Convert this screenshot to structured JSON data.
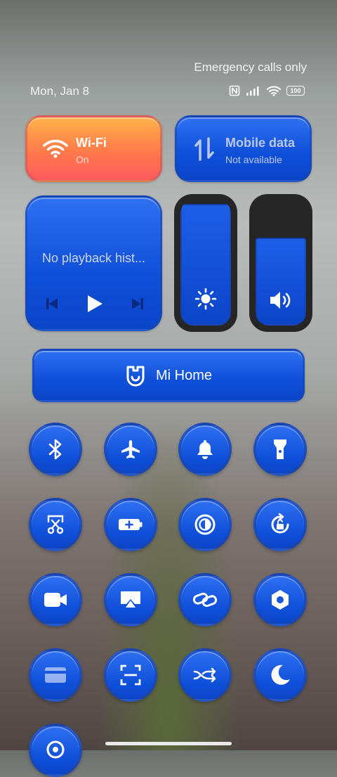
{
  "status": {
    "carrier_text": "Emergency calls only",
    "date": "Mon, Jan 8",
    "battery": "100"
  },
  "tiles": {
    "wifi": {
      "title": "Wi-Fi",
      "subtitle": "On"
    },
    "mobile": {
      "title": "Mobile data",
      "subtitle": "Not available"
    }
  },
  "media": {
    "text": "No playback hist..."
  },
  "sliders": {
    "brightness_level": 0.97,
    "volume_level": 0.7
  },
  "mihome": {
    "label": "Mi Home"
  },
  "toggles": [
    "bluetooth-icon",
    "airplane-icon",
    "bell-icon",
    "flashlight-icon",
    "screenshot-scissors-icon",
    "battery-saver-icon",
    "contrast-icon",
    "rotation-lock-icon",
    "video-camera-icon",
    "cast-icon",
    "link-icon",
    "settings-hex-icon",
    "card-icon",
    "scanner-icon",
    "shuffle-icon",
    "moon-icon",
    "location-icon"
  ]
}
